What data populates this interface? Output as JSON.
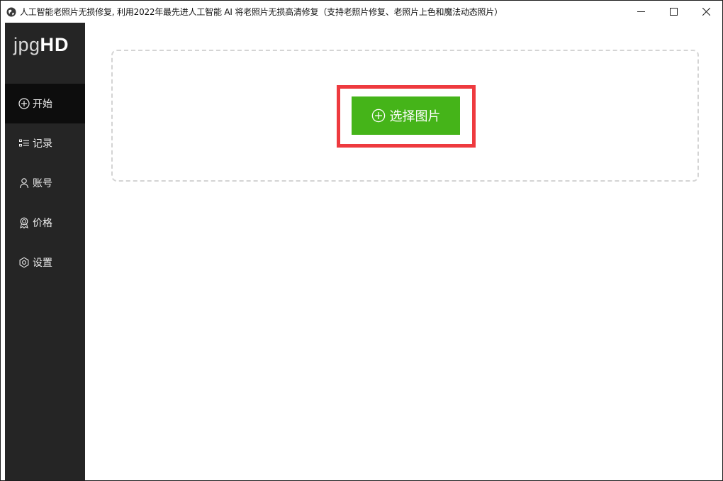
{
  "window": {
    "title": "人工智能老照片无损修复, 利用2022年最先进人工智能 AI 将老照片无损高清修复（支持老照片修复、老照片上色和魔法动态照片）",
    "icon": "globe-icon",
    "controls": [
      "minimize-icon",
      "maximize-icon",
      "close-icon"
    ]
  },
  "sidebar": {
    "logo_light": "jpg",
    "logo_bold": "HD",
    "items": [
      {
        "label": "开始",
        "icon": "plus-circle-icon",
        "active": true
      },
      {
        "label": "记录",
        "icon": "list-icon",
        "active": false
      },
      {
        "label": "账号",
        "icon": "user-icon",
        "active": false
      },
      {
        "label": "价格",
        "icon": "badge-icon",
        "active": false
      },
      {
        "label": "设置",
        "icon": "gear-icon",
        "active": false
      }
    ]
  },
  "main": {
    "select_button_label": "选择图片",
    "select_button_icon": "plus-circle-icon"
  },
  "colors": {
    "sidebar_bg": "#252525",
    "active_item_bg": "#0d0d0d",
    "button_green": "#45b419",
    "highlight_red": "#ee3a3f",
    "dashed_border": "#d4d4d4"
  }
}
